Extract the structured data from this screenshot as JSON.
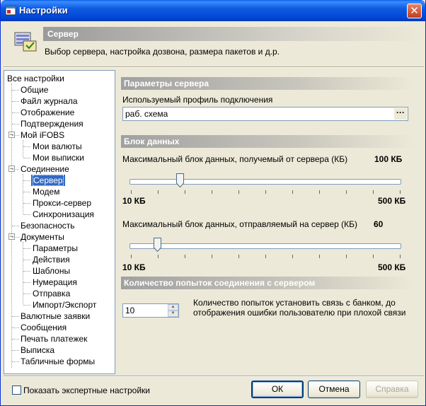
{
  "window": {
    "title": "Настройки",
    "close_glyph": "✕"
  },
  "header": {
    "icon": "server-settings-icon",
    "title": "Сервер",
    "subtitle": "Выбор сервера, настройка дозвона, размера пакетов и д.р."
  },
  "tree": {
    "items": [
      {
        "label": "Все настройки"
      },
      {
        "label": "Общие"
      },
      {
        "label": "Файл журнала"
      },
      {
        "label": "Отображение"
      },
      {
        "label": "Подтверждения"
      },
      {
        "label": "Мой iFOBS",
        "expander": "−"
      },
      {
        "label": "Мои валюты"
      },
      {
        "label": "Мои выписки"
      },
      {
        "label": "Соединение",
        "expander": "−"
      },
      {
        "label": "Сервер",
        "selected": true
      },
      {
        "label": "Модем"
      },
      {
        "label": "Прокси-сервер"
      },
      {
        "label": "Синхронизация"
      },
      {
        "label": "Безопасность"
      },
      {
        "label": "Документы",
        "expander": "−"
      },
      {
        "label": "Параметры"
      },
      {
        "label": "Действия"
      },
      {
        "label": "Шаблоны"
      },
      {
        "label": "Нумерация"
      },
      {
        "label": "Отправка"
      },
      {
        "label": "Импорт/Экспорт"
      },
      {
        "label": "Валютные заявки"
      },
      {
        "label": "Сообщения"
      },
      {
        "label": "Печать платежек"
      },
      {
        "label": "Выписка"
      },
      {
        "label": "Табличные формы"
      }
    ]
  },
  "server_params": {
    "heading": "Параметры сервера",
    "profile_label": "Используемый профиль подключения",
    "profile_value": "раб. схема",
    "browse_glyph": "···"
  },
  "data_block": {
    "heading": "Блок данных",
    "receive_label": "Максимальный блок данных, получемый от сервера (КБ)",
    "receive_value": "100 КБ",
    "receive_fraction": 0.184,
    "receive_min": "10 КБ",
    "receive_max": "500 КБ",
    "send_label": "Максимальный блок данных, отправляемый на сервер (КБ)",
    "send_value": "60",
    "send_fraction": 0.102,
    "send_min": "10 КБ",
    "send_max": "500 КБ"
  },
  "retries": {
    "heading": "Количество попыток соединения с сервером",
    "value": "10",
    "description": "Количество попыток установить связь с банком, до отображения ошибки пользователю при плохой связи"
  },
  "footer": {
    "expert_label": "Показать экспертные настройки",
    "ok_label": "ОК",
    "cancel_label": "Отмена",
    "help_label": "Справка"
  }
}
